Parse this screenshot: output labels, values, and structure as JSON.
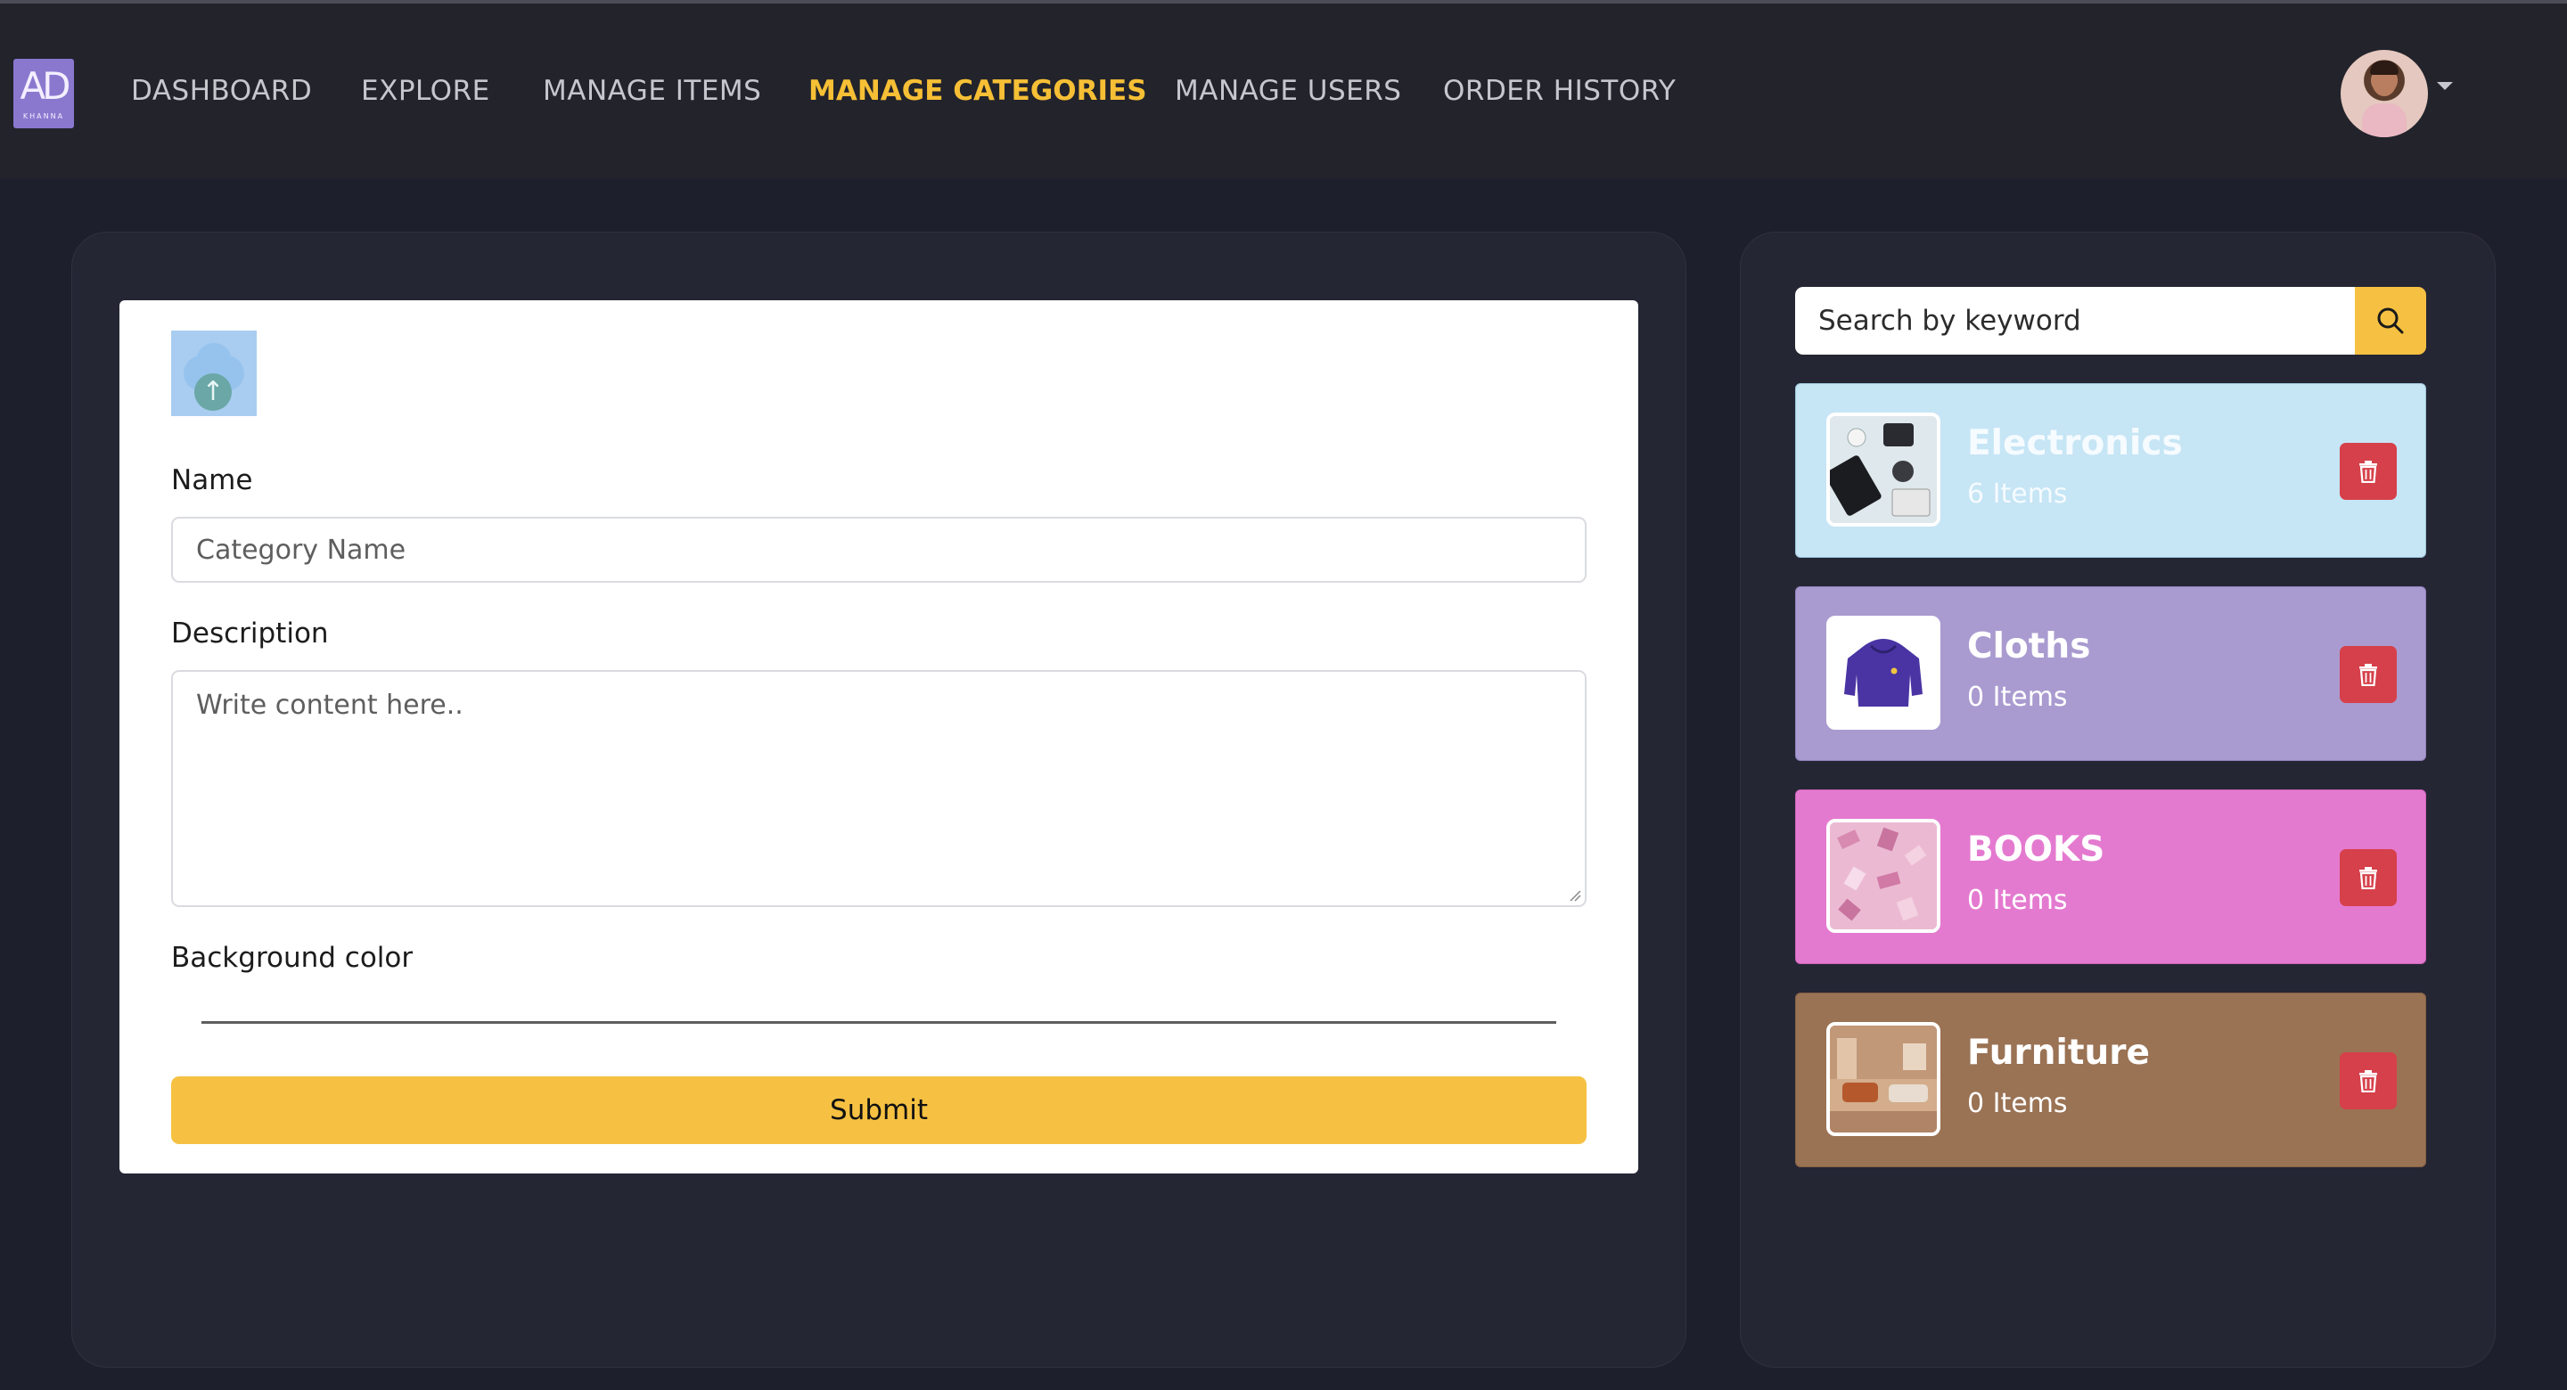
{
  "brand": {
    "logo_text": "AD",
    "logo_subtext": "KHANNA"
  },
  "nav": {
    "links": [
      {
        "label": "DASHBOARD",
        "active": false
      },
      {
        "label": "EXPLORE",
        "active": false
      },
      {
        "label": "MANAGE ITEMS",
        "active": false
      },
      {
        "label": "MANAGE CATEGORIES",
        "active": true
      },
      {
        "label": "MANAGE USERS",
        "active": false
      },
      {
        "label": "ORDER HISTORY",
        "active": false
      }
    ],
    "avatar_icon": "user-avatar",
    "menu_icon": "caret-down-icon"
  },
  "form": {
    "upload_icon": "cloud-upload-icon",
    "name_label": "Name",
    "name_placeholder": "Category Name",
    "description_label": "Description",
    "description_placeholder": "Write content here..",
    "bg_color_label": "Background color",
    "submit_label": "Submit"
  },
  "search": {
    "placeholder": "Search by keyword",
    "icon": "search-icon"
  },
  "categories": [
    {
      "name": "Electronics",
      "count": "6 Items",
      "color": "#c6e5f5"
    },
    {
      "name": "Cloths",
      "count": "0 Items",
      "color": "#a99bd0"
    },
    {
      "name": "BOOKS",
      "count": "0 Items",
      "color": "#e47ad0"
    },
    {
      "name": "Furniture",
      "count": "0 Items",
      "color": "#9a7254"
    }
  ],
  "colors": {
    "accent": "#f6c142",
    "delete": "#d6404a",
    "background": "#1e1f2c",
    "navbar": "#22232b"
  }
}
